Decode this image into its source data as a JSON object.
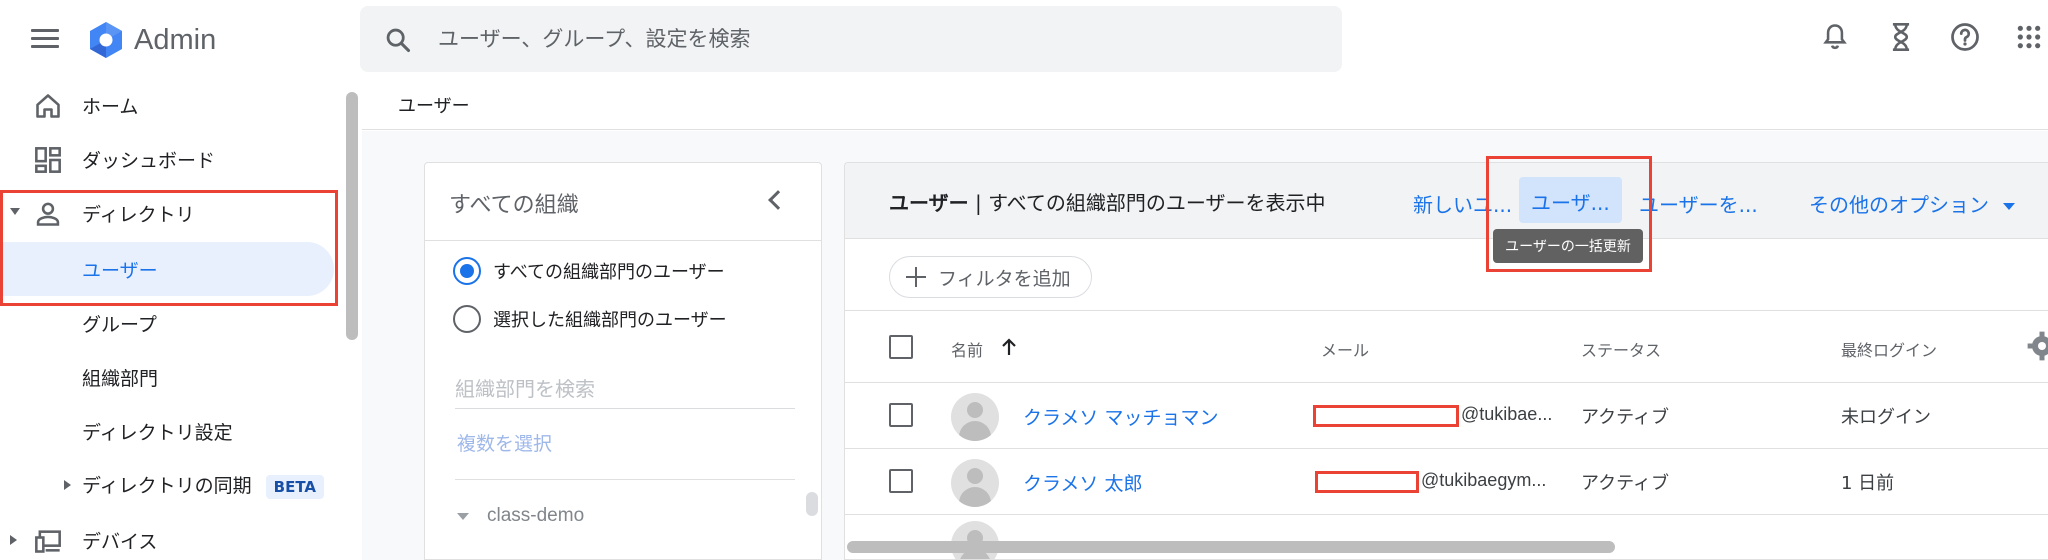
{
  "app": {
    "brand": "Admin"
  },
  "search": {
    "placeholder": "ユーザー、グループ、設定を検索"
  },
  "colors": {
    "accent": "#1a73e8",
    "highlight_box": "#ea4335",
    "active_bg": "#e8f0fe"
  },
  "top_icons": [
    "bell-icon",
    "hourglass-icon",
    "help-icon",
    "apps-grid-icon"
  ],
  "sidebar": {
    "items": [
      {
        "label": "ホーム",
        "icon": "home-icon"
      },
      {
        "label": "ダッシュボード",
        "icon": "dashboard-icon"
      },
      {
        "label": "ディレクトリ",
        "icon": "person-icon",
        "expanded": true
      },
      {
        "label": "ユーザー",
        "active": true
      },
      {
        "label": "グループ"
      },
      {
        "label": "組織部門"
      },
      {
        "label": "ディレクトリ設定"
      },
      {
        "label": "ディレクトリの同期",
        "badge": "BETA"
      },
      {
        "label": "デバイス",
        "icon": "devices-icon"
      }
    ]
  },
  "page": {
    "title": "ユーザー"
  },
  "org_panel": {
    "title": "すべての組織",
    "options": [
      {
        "label": "すべての組織部門のユーザー",
        "checked": true
      },
      {
        "label": "選択した組織部門のユーザー",
        "checked": false
      }
    ],
    "search_placeholder": "組織部門を検索",
    "multi_select": "複数を選択",
    "tree": [
      {
        "label": "class-demo"
      }
    ]
  },
  "users_panel": {
    "title_bold": "ユーザー",
    "title_rest": " | すべての組織部門のユーザーを表示中",
    "actions": {
      "new_user": "新しいユ...",
      "bulk_update": "ユーザ...",
      "download": "ユーザーを...",
      "more": "その他のオプション"
    },
    "tooltip": "ユーザーの一括更新",
    "filter": "フィルタを追加",
    "columns": {
      "name": "名前",
      "email": "メール",
      "status": "ステータス",
      "last_login": "最終ログイン"
    },
    "rows": [
      {
        "name": "クラメソ マッチョマン",
        "email_suffix": "@tukibae...",
        "status": "アクティブ",
        "last_login": "未ログイン"
      },
      {
        "name": "クラメソ 太郎",
        "email_suffix": "@tukibaegym...",
        "status": "アクティブ",
        "last_login": "1 日前"
      }
    ]
  }
}
